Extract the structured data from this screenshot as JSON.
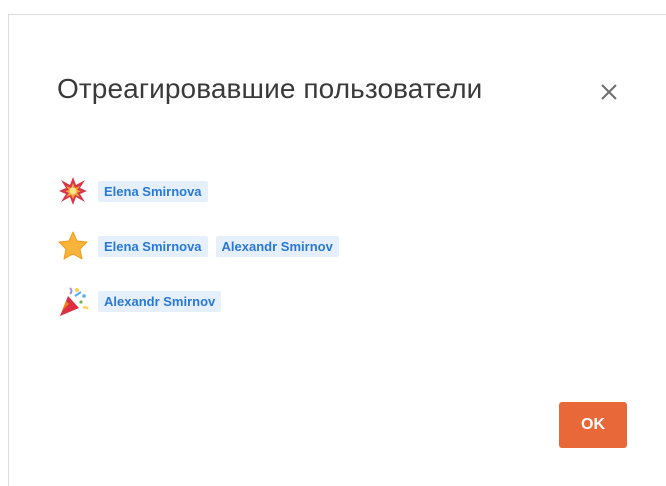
{
  "dialog": {
    "title": "Отреагировавшие пользователи",
    "close_icon": "close-icon",
    "ok_label": "OK"
  },
  "reactions": [
    {
      "emoji": "collision-icon",
      "users": [
        "Elena Smirnova"
      ]
    },
    {
      "emoji": "star-icon",
      "users": [
        "Elena Smirnova",
        "Alexandr Smirnov"
      ]
    },
    {
      "emoji": "party-popper-icon",
      "users": [
        "Alexandr Smirnov"
      ]
    }
  ],
  "colors": {
    "chip_background": "#e6f0fc",
    "chip_text": "#2a78d6",
    "ok_button": "#e8683a",
    "title_text": "#3a3a3a"
  }
}
